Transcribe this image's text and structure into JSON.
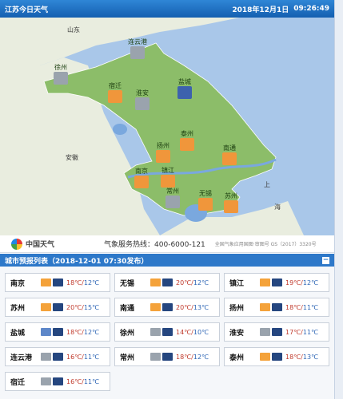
{
  "header": {
    "title": "江苏今日天气",
    "date": "2018年12月1日",
    "time": "09:26:49"
  },
  "map": {
    "regions": {
      "shandong": "山东",
      "anhui": "安徽",
      "shanghai": "上",
      "sea": "海"
    },
    "cities": [
      {
        "key": "lianyungang",
        "name": "连云港",
        "weather": "cloudy"
      },
      {
        "key": "xuzhou",
        "name": "徐州",
        "weather": "cloudy"
      },
      {
        "key": "suqian",
        "name": "宿迁",
        "weather": "sunny"
      },
      {
        "key": "huaian",
        "name": "淮安",
        "weather": "cloudy"
      },
      {
        "key": "yancheng",
        "name": "盐城",
        "weather": "rain"
      },
      {
        "key": "taizhou",
        "name": "泰州",
        "weather": "sunny"
      },
      {
        "key": "yangzhou",
        "name": "扬州",
        "weather": "sunny"
      },
      {
        "key": "nantong",
        "name": "南通",
        "weather": "sunny"
      },
      {
        "key": "nanjing",
        "name": "南京",
        "weather": "sunny"
      },
      {
        "key": "zhenjiang",
        "name": "镇江",
        "weather": "sunny"
      },
      {
        "key": "changzhou",
        "name": "常州",
        "weather": "cloudy"
      },
      {
        "key": "wuxi",
        "name": "无锡",
        "weather": "sunny"
      },
      {
        "key": "suzhou",
        "name": "苏州",
        "weather": "sunny"
      }
    ]
  },
  "service": {
    "logo": "中国天气",
    "hotline": "气象服务热线：400-6000-121",
    "copyright": "全国气象应用国图·审图号 GS（2017）3320号"
  },
  "forecast": {
    "title": "城市预报列表（2018-12-01 07:30发布）",
    "items": [
      {
        "city": "南京",
        "day": "sun",
        "night": "night",
        "hi": "18℃",
        "lo": "12℃"
      },
      {
        "city": "无锡",
        "day": "sun",
        "night": "night",
        "hi": "20℃",
        "lo": "12℃"
      },
      {
        "city": "镇江",
        "day": "sun",
        "night": "night",
        "hi": "19℃",
        "lo": "12℃"
      },
      {
        "city": "苏州",
        "day": "sun",
        "night": "night",
        "hi": "20℃",
        "lo": "15℃"
      },
      {
        "city": "南通",
        "day": "sun",
        "night": "night",
        "hi": "20℃",
        "lo": "13℃"
      },
      {
        "city": "扬州",
        "day": "sun",
        "night": "night",
        "hi": "18℃",
        "lo": "11℃"
      },
      {
        "city": "盐城",
        "day": "rain",
        "night": "night",
        "hi": "18℃",
        "lo": "12℃"
      },
      {
        "city": "徐州",
        "day": "cloud",
        "night": "night",
        "hi": "14℃",
        "lo": "10℃"
      },
      {
        "city": "淮安",
        "day": "cloud",
        "night": "night",
        "hi": "17℃",
        "lo": "11℃"
      },
      {
        "city": "连云港",
        "day": "cloud",
        "night": "night",
        "hi": "16℃",
        "lo": "11℃"
      },
      {
        "city": "常州",
        "day": "cloud",
        "night": "night",
        "hi": "18℃",
        "lo": "12℃"
      },
      {
        "city": "泰州",
        "day": "sun",
        "night": "night",
        "hi": "18℃",
        "lo": "13℃"
      },
      {
        "city": "宿迁",
        "day": "cloud",
        "night": "night",
        "hi": "16℃",
        "lo": "11℃"
      }
    ]
  }
}
